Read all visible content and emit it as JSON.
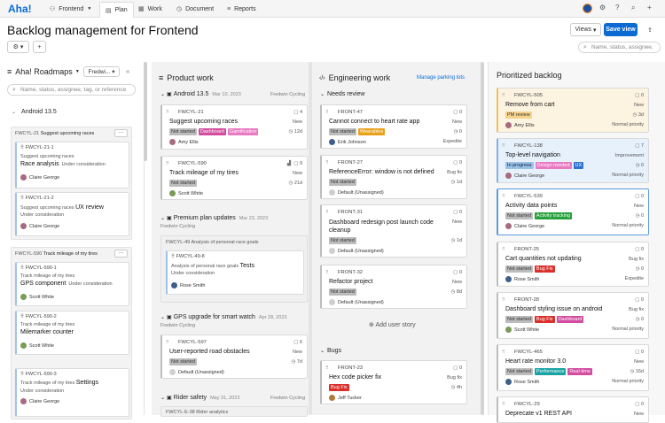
{
  "nav": {
    "logo": "Aha!",
    "workspace": "Frontend",
    "tabs": [
      {
        "label": "Plan",
        "icon": "▤"
      },
      {
        "label": "Work",
        "icon": "▦"
      },
      {
        "label": "Document",
        "icon": "◷"
      },
      {
        "label": "Reports",
        "icon": "≡"
      }
    ]
  },
  "page": {
    "title": "Backlog management for Frontend",
    "views_label": "Views",
    "save_label": "Save view",
    "search_placeholder": "Name, status, assignee,"
  },
  "left": {
    "title": "Aha! Roadmaps",
    "filter": "Fredwi...",
    "search_placeholder": "Name, status, assignee, tag, or reference",
    "release": "Android 13.5",
    "groups": [
      {
        "ref": "FWCYL-21",
        "name": "Suggest upcoming races",
        "cards": [
          {
            "id": "FWCYL-21-1",
            "parent": "Suggest upcoming races",
            "name": "Race analysis",
            "status": "Under consideration",
            "user": "Claire George",
            "av": "p"
          },
          {
            "id": "FWCYL-21-2",
            "parent": "Suggest upcoming races",
            "name": "UX review",
            "status": "Under consideration",
            "user": "Claire George",
            "av": "p"
          }
        ]
      },
      {
        "ref": "FWCYL-590",
        "name": "Track mileage of my tires",
        "cards": [
          {
            "id": "FWCYL-590-1",
            "parent": "Track mileage of my tires",
            "name": "GPS component",
            "status": "Under consideration",
            "user": "Scott White",
            "av": "g"
          },
          {
            "id": "FWCYL-590-2",
            "parent": "Track mileage of my tires",
            "name": "Milemarker counter",
            "status": "",
            "user": "Scott White",
            "av": "g"
          },
          {
            "id": "FWCYL-590-3",
            "parent": "Track mileage of my tires",
            "name": "Settings",
            "status": "Under consideration",
            "user": "Claire George",
            "av": "p"
          }
        ]
      }
    ]
  },
  "product": {
    "title": "Product work",
    "sections": [
      {
        "name": "Android 13.5",
        "date": "Mar 10, 2023",
        "owner": "Fredwin Cycling"
      },
      {
        "name": "Premium plan updates",
        "date": "Mar 23, 2023",
        "owner": "Fredwin Cycling"
      },
      {
        "name": "GPS upgrade for smart watch",
        "date": "Apr 28, 2023",
        "owner": "Fredwin Cycling"
      },
      {
        "name": "Rider safety",
        "date": "May 31, 2023",
        "owner": "Fredwin Cycling"
      }
    ],
    "cards": [
      {
        "id": "FWCYL-21",
        "title": "Suggest upcoming races",
        "type": "New",
        "count": "4",
        "status": "Not started",
        "tags": [
          {
            "t": "Dashboard",
            "c": "t-pink"
          },
          {
            "t": "Gamification",
            "c": "t-lpink"
          }
        ],
        "meta": "12d",
        "user": "Amy Ellis",
        "av": "p"
      },
      {
        "id": "FWCYL-590",
        "title": "Track mileage of my tires",
        "type": "New",
        "count": "9",
        "status": "Not started",
        "tags": [],
        "meta": "21d",
        "user": "Scott White",
        "av": "g"
      },
      {
        "id": "FWCYL-597",
        "title": "User-reported road obstacles",
        "type": "New",
        "count": "6",
        "status": "Not started",
        "tags": [],
        "meta": "7d",
        "user": "Default (Unassigned)",
        "av": "gray"
      }
    ],
    "subgroup": {
      "ref": "FWCYL-49",
      "name": "Analysis of personal race goals",
      "child_id": "FWCYL-49-8",
      "child_parent": "Analysis of personal race goals",
      "child_name": "Tests",
      "child_status": "Under consideration",
      "child_user": "Rose Smith"
    },
    "partial": "FWCYL-E-38 Rider analytics"
  },
  "eng": {
    "title": "Engineering work",
    "link": "Manage parking lots",
    "sec1": "Needs review",
    "sec2": "Bugs",
    "add_story": "Add user story",
    "cards": [
      {
        "id": "FRONT-47",
        "title": "Cannot connect to heart rate app",
        "type": "New",
        "count": "0",
        "status": "Not started",
        "tags": [
          {
            "t": "Wearables",
            "c": "t-orange"
          }
        ],
        "meta": "Expedite",
        "user": "Erik Johnson",
        "av": "b"
      },
      {
        "id": "FRONT-27",
        "title": "ReferenceError: window is not defined",
        "type": "Bug fix",
        "count": "0",
        "status": "Not started",
        "tags": [],
        "meta": "1d",
        "user": "Default (Unassigned)",
        "av": "gray"
      },
      {
        "id": "FRONT-31",
        "title": "Dashboard redesign post launch code cleanup",
        "type": "New",
        "count": "0",
        "status": "Not started",
        "tags": [],
        "meta": "1d",
        "user": "Default (Unassigned)",
        "av": "gray"
      },
      {
        "id": "FRONT-32",
        "title": "Refactor project",
        "type": "New",
        "count": "0",
        "status": "Not started",
        "tags": [],
        "meta": "8d",
        "user": "Default (Unassigned)",
        "av": "gray"
      },
      {
        "id": "FRONT-23",
        "title": "Hex code picker fix",
        "type": "Bug fix",
        "count": "0",
        "status": "Not started",
        "tags": [
          {
            "t": "Bug Fix",
            "c": "t-red"
          }
        ],
        "meta": "4h",
        "user": "Jeff Tucker",
        "av": "y"
      }
    ]
  },
  "backlog": {
    "title": "Prioritized backlog",
    "cards": [
      {
        "id": "FWCYL-505",
        "title": "Remove from cart",
        "type": "New",
        "count": "0",
        "status": "PM review",
        "sc": "rev",
        "tags": [],
        "meta": "3d",
        "user": "Amy Ellis",
        "av": "p",
        "prio": "Normal priority"
      },
      {
        "id": "FWCYL-138",
        "title": "Top-level navigation",
        "type": "Improvement",
        "count": "7",
        "status": "In progress",
        "sc": "prog",
        "tags": [
          {
            "t": "Design needed",
            "c": "t-lpink"
          },
          {
            "t": "UX",
            "c": "t-blue"
          }
        ],
        "meta": "0",
        "user": "Claire George",
        "av": "p",
        "prio": "Normal priority"
      },
      {
        "id": "FWCYL-539",
        "title": "Activity data points",
        "type": "New",
        "count": "0",
        "status": "Not started",
        "sc": "",
        "tags": [
          {
            "t": "Activity tracking",
            "c": "t-green"
          }
        ],
        "meta": "0",
        "user": "Claire George",
        "av": "p",
        "prio": "Normal priority"
      },
      {
        "id": "FRONT-25",
        "title": "Cart quantities not updating",
        "type": "Bug fix",
        "count": "0",
        "status": "Not started",
        "sc": "",
        "tags": [
          {
            "t": "Bug Fix",
            "c": "t-red"
          }
        ],
        "meta": "0",
        "user": "Rose Smith",
        "av": "b",
        "prio": "Expedite"
      },
      {
        "id": "FRONT-28",
        "title": "Dashboard styling issue on android",
        "type": "Bug fix",
        "count": "0",
        "status": "Not started",
        "sc": "",
        "tags": [
          {
            "t": "Bug Fix",
            "c": "t-red"
          },
          {
            "t": "Dashboard",
            "c": "t-pink"
          }
        ],
        "meta": "0",
        "user": "Scott White",
        "av": "g",
        "prio": "Normal priority"
      },
      {
        "id": "FWCYL-465",
        "title": "Heart rate monitor 3.0",
        "type": "New",
        "count": "0",
        "status": "Not started",
        "sc": "",
        "tags": [
          {
            "t": "Performance",
            "c": "t-teal"
          },
          {
            "t": "Real-time",
            "c": "t-pink"
          }
        ],
        "meta": "16d",
        "user": "Rose Smith",
        "av": "b",
        "prio": "Normal priority"
      },
      {
        "id": "FWCYL-29",
        "title": "Deprecate v1 REST API",
        "type": "New",
        "count": "0",
        "status": "",
        "sc": "",
        "tags": [],
        "meta": "",
        "user": "",
        "av": "gray",
        "prio": ""
      }
    ]
  }
}
